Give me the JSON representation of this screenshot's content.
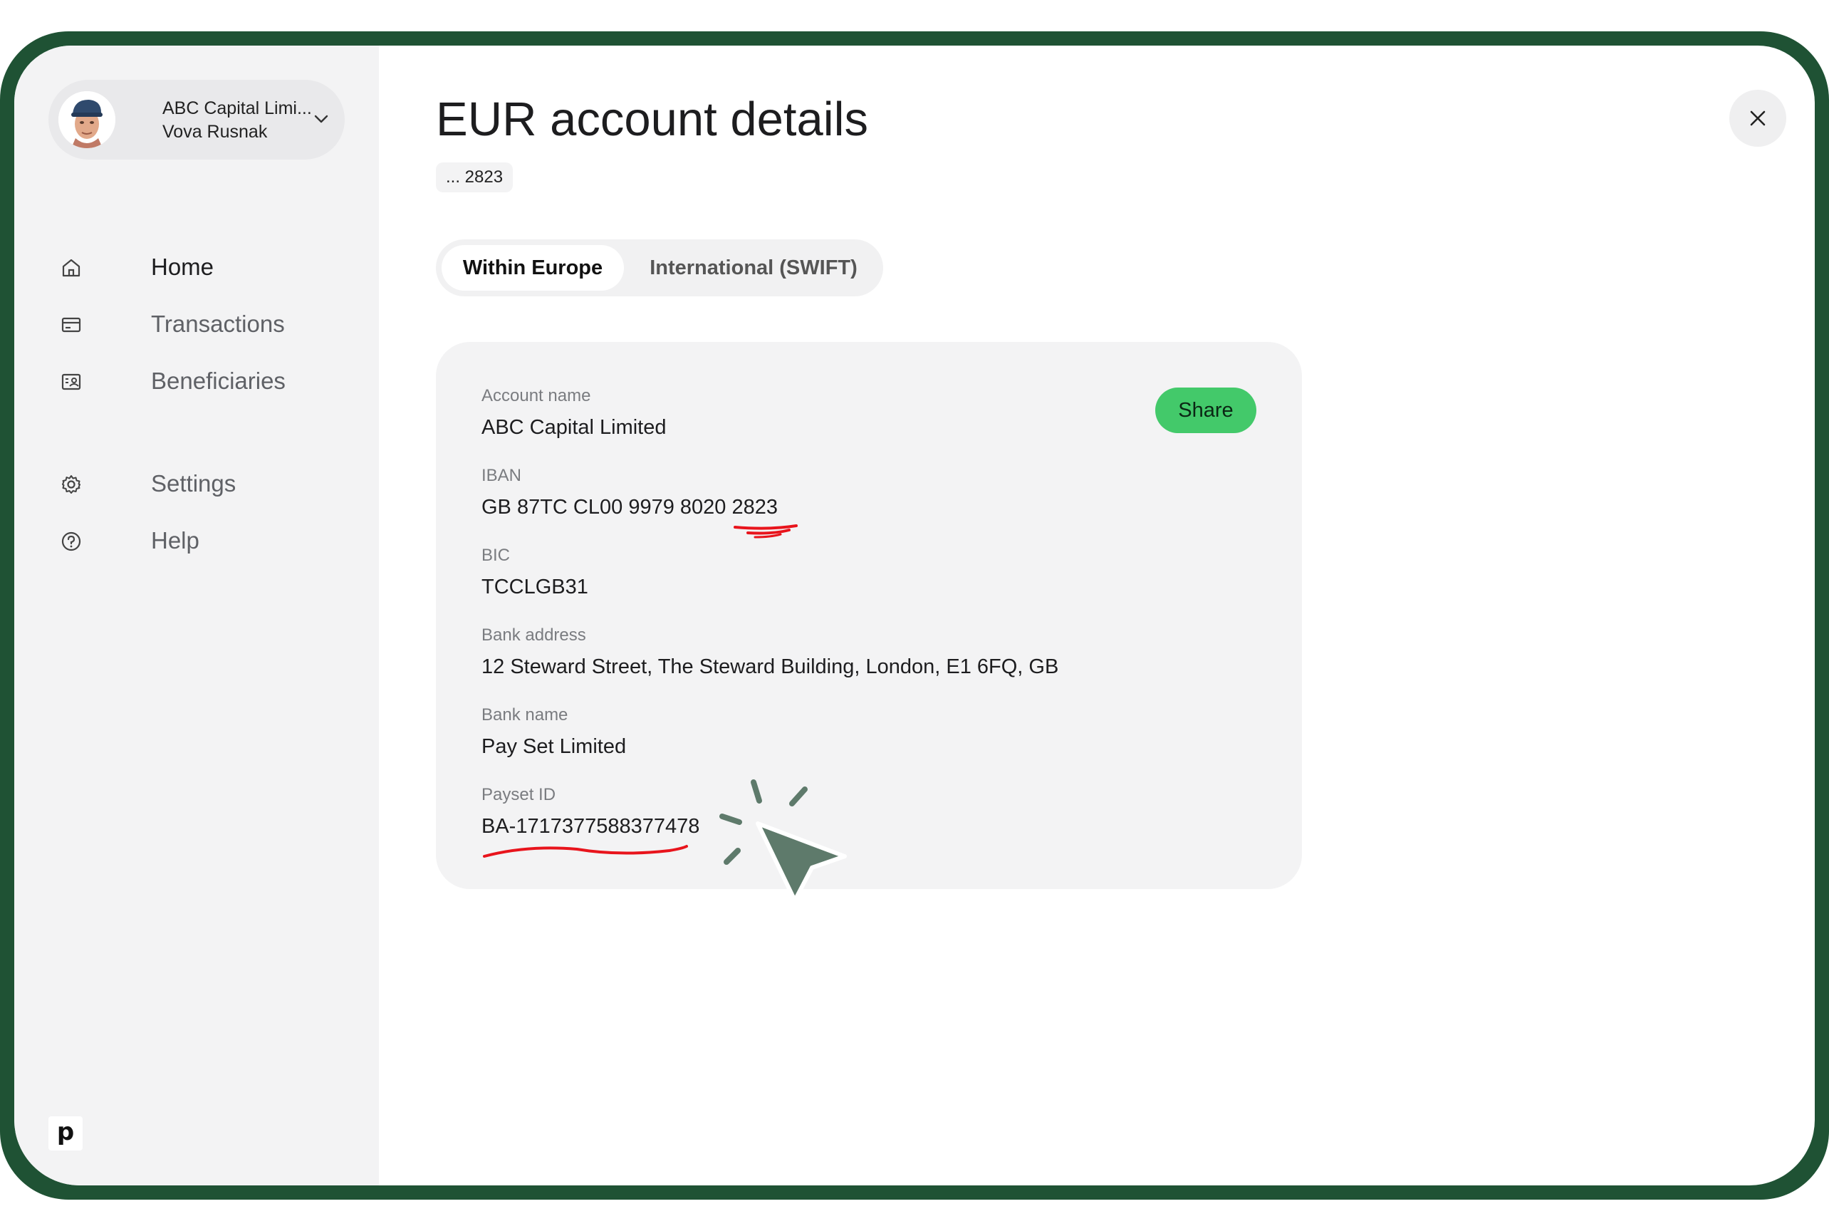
{
  "account_switcher": {
    "company": "ABC Capital Limi...",
    "user": "Vova Rusnak"
  },
  "nav": {
    "home": "Home",
    "transactions": "Transactions",
    "beneficiaries": "Beneficiaries",
    "settings": "Settings",
    "help": "Help"
  },
  "brand": {
    "glyph": "p"
  },
  "main": {
    "title": "EUR account details",
    "account_suffix": "... 2823"
  },
  "tabs": {
    "within_europe": "Within Europe",
    "international": "International (SWIFT)",
    "selected": "Within Europe"
  },
  "details": {
    "share_label": "Share",
    "fields": [
      {
        "label": "Account name",
        "value": "ABC Capital Limited"
      },
      {
        "label": "IBAN",
        "value": "GB 87TC CL00 9979 8020 2823"
      },
      {
        "label": "BIC",
        "value": "TCCLGB31"
      },
      {
        "label": "Bank address",
        "value": "12 Steward Street, The Steward Building, London, E1 6FQ, GB"
      },
      {
        "label": "Bank name",
        "value": "Pay Set Limited"
      },
      {
        "label": "Payset ID",
        "value": "BA-1717377588377478"
      }
    ]
  },
  "colors": {
    "frame": "#1f5234",
    "sidebar": "#f3f3f4",
    "accent_green": "#43c96a",
    "annotation_red": "#e8141c",
    "cursor": "#5e7a6b"
  },
  "icons": [
    "chevron-down-icon",
    "home-icon",
    "card-icon",
    "beneficiaries-icon",
    "settings-icon",
    "help-icon",
    "close-icon",
    "cursor-icon"
  ]
}
